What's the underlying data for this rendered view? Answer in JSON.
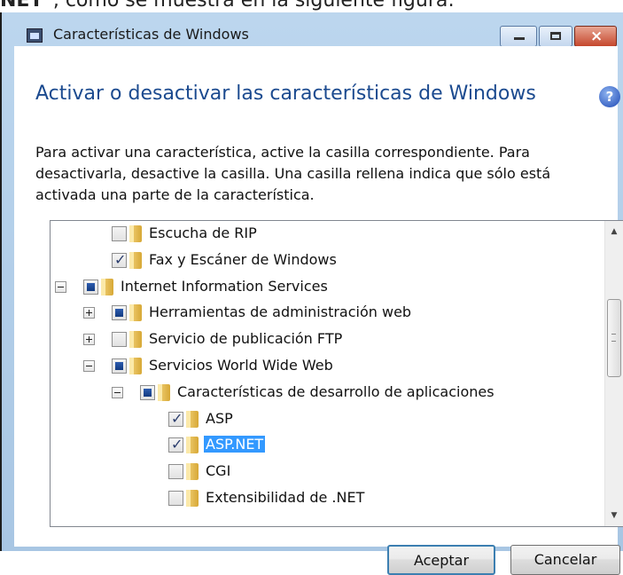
{
  "context": {
    "prefix": "NET",
    "text": "”, como se muestra en la siguiente figura:"
  },
  "window": {
    "title": "Características de Windows",
    "controls": {
      "minimize": "minimize",
      "maximize": "maximize",
      "close": "×"
    }
  },
  "heading": "Activar o desactivar las características de Windows",
  "help_icon": "?",
  "description": "Para activar una característica, active la casilla correspondiente. Para desactivarla, desactive la casilla. Una casilla rellena indica que sólo está activada una parte de la característica.",
  "tree": {
    "items": [
      {
        "label": "Escucha de RIP",
        "state": "unchecked",
        "expander": "none",
        "selected": false
      },
      {
        "label": "Fax y Escáner de Windows",
        "state": "checked",
        "expander": "none",
        "selected": false
      },
      {
        "label": "Internet Information Services",
        "state": "partial",
        "expander": "minus",
        "selected": false
      },
      {
        "label": "Herramientas de administración web",
        "state": "partial",
        "expander": "plus",
        "selected": false
      },
      {
        "label": "Servicio de publicación FTP",
        "state": "unchecked",
        "expander": "plus",
        "selected": false
      },
      {
        "label": "Servicios World Wide Web",
        "state": "partial",
        "expander": "minus",
        "selected": false
      },
      {
        "label": "Características de desarrollo de aplicaciones",
        "state": "partial",
        "expander": "minus",
        "selected": false
      },
      {
        "label": "ASP",
        "state": "checked",
        "expander": "none",
        "selected": false
      },
      {
        "label": "ASP.NET",
        "state": "checked",
        "expander": "none",
        "selected": true
      },
      {
        "label": "CGI",
        "state": "unchecked",
        "expander": "none",
        "selected": false
      },
      {
        "label": "Extensibilidad de .NET",
        "state": "unchecked",
        "expander": "none",
        "selected": false
      }
    ]
  },
  "buttons": {
    "ok": "Aceptar",
    "cancel": "Cancelar"
  },
  "colors": {
    "heading": "#1b4a8f",
    "selection": "#3399ff",
    "frame": "#bcd6ee"
  }
}
